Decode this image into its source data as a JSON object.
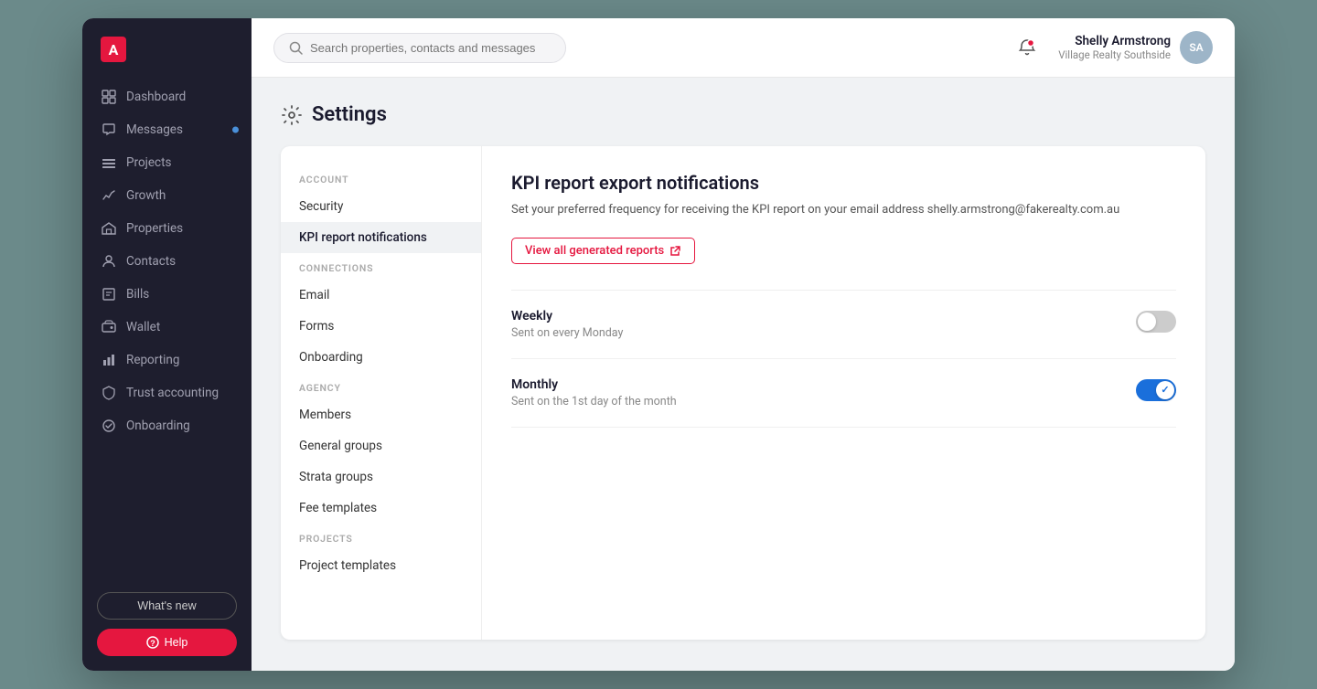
{
  "sidebar": {
    "logo": "A",
    "nav_items": [
      {
        "id": "dashboard",
        "label": "Dashboard",
        "icon": "dashboard"
      },
      {
        "id": "messages",
        "label": "Messages",
        "icon": "messages",
        "dot": true
      },
      {
        "id": "projects",
        "label": "Projects",
        "icon": "projects"
      },
      {
        "id": "growth",
        "label": "Growth",
        "icon": "growth"
      },
      {
        "id": "properties",
        "label": "Properties",
        "icon": "properties"
      },
      {
        "id": "contacts",
        "label": "Contacts",
        "icon": "contacts"
      },
      {
        "id": "bills",
        "label": "Bills",
        "icon": "bills"
      },
      {
        "id": "wallet",
        "label": "Wallet",
        "icon": "wallet"
      },
      {
        "id": "reporting",
        "label": "Reporting",
        "icon": "reporting"
      },
      {
        "id": "trust-accounting",
        "label": "Trust accounting",
        "icon": "trust"
      },
      {
        "id": "onboarding",
        "label": "Onboarding",
        "icon": "onboarding"
      }
    ],
    "whats_new": "What's new",
    "help": "Help"
  },
  "header": {
    "search_placeholder": "Search properties, contacts and messages",
    "user": {
      "name": "Shelly Armstrong",
      "company": "Village Realty Southside",
      "initials": "SA"
    }
  },
  "page": {
    "title": "Settings",
    "settings_sidebar": {
      "sections": [
        {
          "label": "ACCOUNT",
          "items": [
            {
              "id": "security",
              "label": "Security",
              "active": false
            },
            {
              "id": "kpi-notifications",
              "label": "KPI report notifications",
              "active": true
            }
          ]
        },
        {
          "label": "CONNECTIONS",
          "items": [
            {
              "id": "email",
              "label": "Email",
              "active": false
            },
            {
              "id": "forms",
              "label": "Forms",
              "active": false
            },
            {
              "id": "onboarding",
              "label": "Onboarding",
              "active": false
            }
          ]
        },
        {
          "label": "AGENCY",
          "items": [
            {
              "id": "members",
              "label": "Members",
              "active": false
            },
            {
              "id": "general-groups",
              "label": "General groups",
              "active": false
            },
            {
              "id": "strata-groups",
              "label": "Strata groups",
              "active": false
            },
            {
              "id": "fee-templates",
              "label": "Fee templates",
              "active": false
            }
          ]
        },
        {
          "label": "PROJECTS",
          "items": [
            {
              "id": "project-templates",
              "label": "Project templates",
              "active": false
            }
          ]
        }
      ]
    },
    "kpi_section": {
      "title": "KPI report export notifications",
      "description": "Set your preferred frequency for receiving the KPI report on your email address shelly.armstrong@fakerealty.com.au",
      "view_reports_label": "View all generated reports",
      "toggles": [
        {
          "id": "weekly",
          "label": "Weekly",
          "sublabel": "Sent on every Monday",
          "enabled": false
        },
        {
          "id": "monthly",
          "label": "Monthly",
          "sublabel": "Sent on the 1st day of the month",
          "enabled": true
        }
      ]
    }
  }
}
